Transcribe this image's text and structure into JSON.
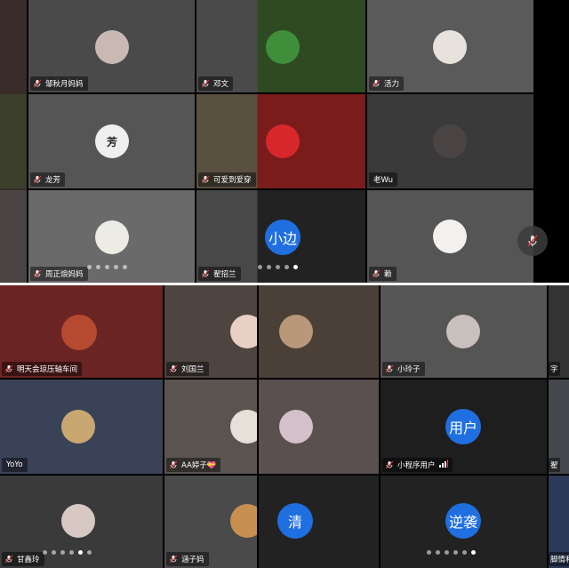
{
  "top_panel": {
    "tiles": [
      {
        "name": "邹秋月妈妈",
        "bg": "#4a4a4a",
        "avatar": "#c9b8b4"
      },
      {
        "name": "邓文",
        "bg": "#3f4a3a",
        "avatar": "#3f8f3a"
      },
      {
        "name": "活力",
        "bg": "#5a5a5a",
        "avatar": "#e8e2dc"
      },
      {
        "name": "龙芳",
        "bg": "#555555",
        "avatar": "#efefef",
        "avatar_text": "芳"
      },
      {
        "name": "可爱到爱穿",
        "bg": "#7a1c1c",
        "avatar": "#d8282c"
      },
      {
        "name": "老Wu",
        "bg": "#3a3a3a",
        "avatar": "#4a4444"
      },
      {
        "name": "周正烺妈妈",
        "bg": "#6a6a6a",
        "avatar": "#ecebe4"
      },
      {
        "name": "翟招兰",
        "text_avatar": "小边",
        "bg": "#2a2a2a"
      },
      {
        "name": "赖",
        "bg": "#555555",
        "avatar": "#f4f0ee"
      }
    ],
    "page_dots": 5,
    "active_dot": 4
  },
  "bottom_panel": {
    "tiles": [
      {
        "name": "明天会琼压轴车间",
        "bg": "#6b2424",
        "avatar": "#b64a30"
      },
      {
        "name": "刘国兰",
        "bg": "#4e4440",
        "avatar": "#e8d0c4"
      },
      {
        "name": "",
        "bg": "#4a4038",
        "avatar": "#b89878"
      },
      {
        "name": "小玲子",
        "bg": "#555555",
        "avatar": "#c8c0bc"
      },
      {
        "name": "字",
        "bg": "#333333"
      },
      {
        "name": "YoYo",
        "bg": "#3a4258",
        "avatar": "#c8a870"
      },
      {
        "name": "AA婷子💝",
        "bg": "#5a5450",
        "avatar": "#e6e0d8"
      },
      {
        "name": "",
        "bg": "#5a5050",
        "avatar": "#d4c0c8"
      },
      {
        "name": "小程序用户",
        "text_avatar": "用户",
        "bg": "#1e1e1e"
      },
      {
        "name": "翟",
        "bg": "#44484c"
      },
      {
        "name": "甘鑫玲",
        "bg": "#3a3a3a",
        "avatar": "#d8c8c4"
      },
      {
        "name": "涵子妈",
        "bg": "#4a4a4a",
        "avatar": "#c89050"
      },
      {
        "name": "",
        "text_avatar": "清",
        "bg": "#222222"
      },
      {
        "name": "",
        "text_avatar": "逆袭",
        "bg": "#222222"
      },
      {
        "name": "脚情和",
        "bg": "#2c3a5a"
      }
    ],
    "page_dots": 5,
    "active_dot": 3
  },
  "controls": {
    "mute_icon": "mic-off-icon"
  }
}
